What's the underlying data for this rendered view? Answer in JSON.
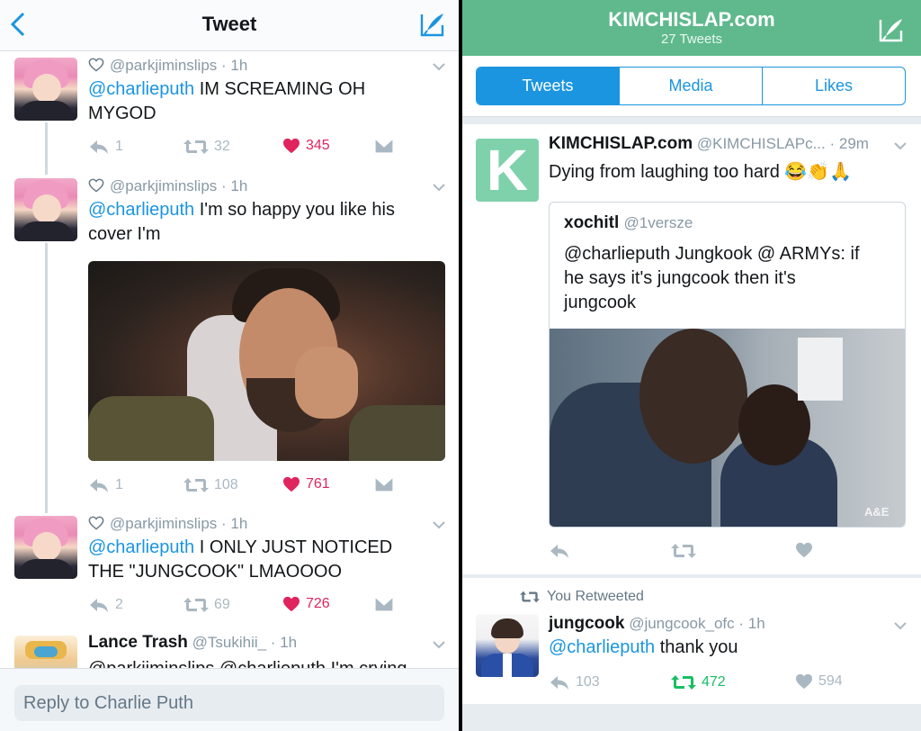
{
  "left": {
    "nav": {
      "title": "Tweet"
    },
    "tweets": [
      {
        "handle": "@parkjiminslips",
        "time": "1h",
        "mention": "@charlieputh",
        "text_line1": " IM SCREAMING OH",
        "text_line2": "MYGOD",
        "replies": "1",
        "retweets": "32",
        "likes": "345"
      },
      {
        "handle": "@parkjiminslips",
        "time": "1h",
        "mention": "@charlieputh",
        "text_line1": " I'm so happy you like his",
        "text_line2": "cover I'm",
        "replies": "1",
        "retweets": "108",
        "likes": "761"
      },
      {
        "handle": "@parkjiminslips",
        "time": "1h",
        "mention": "@charlieputh",
        "text_line1": " I ONLY JUST NOTICED",
        "text_line2": "THE \"JUNGCOOK\" LMAOOOO",
        "replies": "2",
        "retweets": "69",
        "likes": "726"
      },
      {
        "name": "Lance Trash",
        "handle": "@Tsukihii_",
        "time": "1h",
        "partial_text": "@parkjiminslips @charlieputh I'm crying"
      }
    ],
    "reply_placeholder": "Reply to Charlie Puth"
  },
  "right": {
    "header": {
      "title": "KIMCHISLAP.com",
      "subtitle": "27 Tweets"
    },
    "tabs": [
      {
        "label": "Tweets",
        "active": true
      },
      {
        "label": "Media",
        "active": false
      },
      {
        "label": "Likes",
        "active": false
      }
    ],
    "tweet1": {
      "logo_letter": "K",
      "name": "KIMCHISLAP.com",
      "handle": "@KIMCHISLAPc...",
      "time": "29m",
      "text": "Dying from laughing too hard 😂👏🙏",
      "quote": {
        "name": "xochitl",
        "handle": "@1versze",
        "mention": "@charlieputh",
        "text_line1": " Jungkook @ ARMYs: if",
        "text_line2": "he says it's jungcook then it's",
        "text_line3": "jungcook",
        "watermark": "A&E"
      }
    },
    "tweet2": {
      "retweet_context": "You Retweeted",
      "name": "jungcook",
      "handle": "@jungcook_ofc",
      "time": "1h",
      "mention": "@charlieputh",
      "text": " thank you",
      "replies": "103",
      "retweets": "472",
      "likes": "594"
    }
  },
  "colors": {
    "twitter_blue": "#1b95e0",
    "like_red": "#e0245e",
    "retweet_green": "#17bf63",
    "header_green": "#5fb98d",
    "muted_gray": "#8899a6"
  },
  "icons": [
    "back-chevron-icon",
    "compose-icon",
    "heart-outline-icon",
    "chevron-down-icon",
    "reply-icon",
    "retweet-icon",
    "heart-icon",
    "dm-icon"
  ]
}
